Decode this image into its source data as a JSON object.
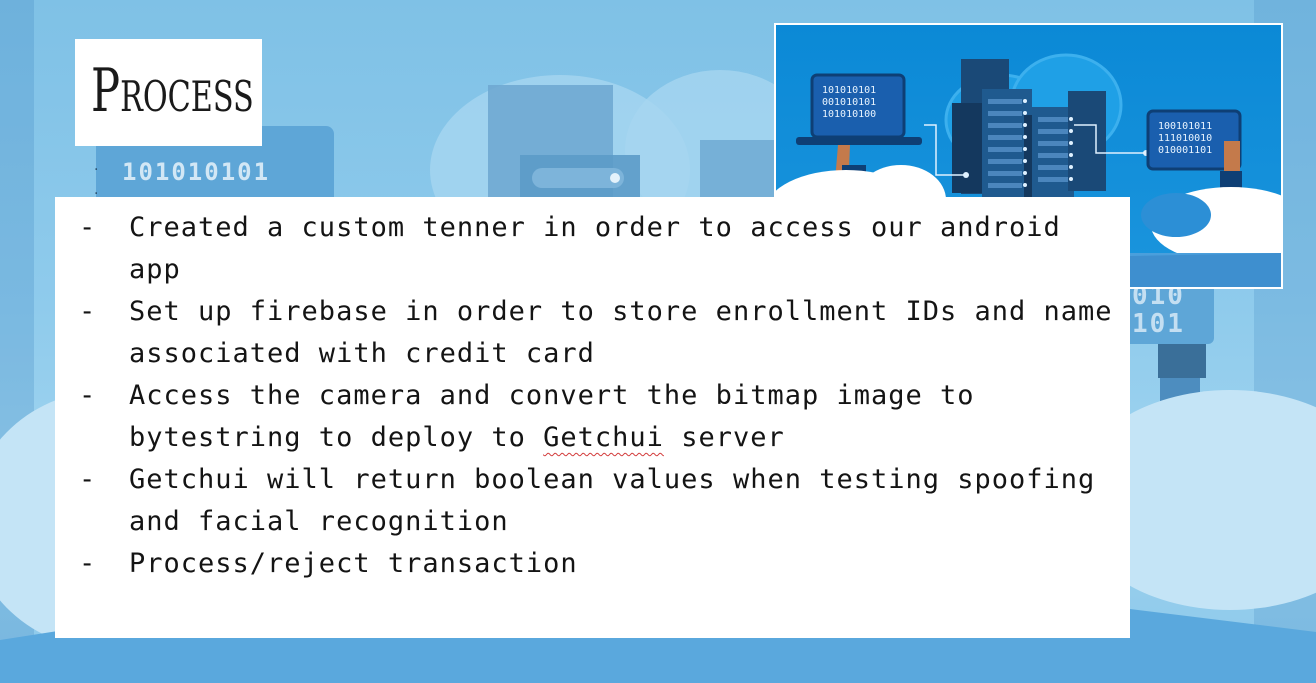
{
  "slide": {
    "title": "Process",
    "background_binary_1": "101010101",
    "background_binary_2_line1": "010",
    "background_binary_2_line2": "101",
    "illustration": {
      "laptop_binary": [
        "101010101",
        "001010101",
        "101010100"
      ],
      "monitor_binary": [
        "100101011",
        "111010010",
        "010001101"
      ]
    },
    "bullets": [
      {
        "text": "Created a custom tenner in order to access our android app"
      },
      {
        "text": "Set up firebase in order to store enrollment IDs and name associated with credit card"
      },
      {
        "text_before": "Access the camera and convert the bitmap image to bytestring to deploy to ",
        "flagged_word": "Getchui",
        "text_after": " server"
      },
      {
        "text": "Getchui will return boolean values when testing spoofing and facial recognition"
      },
      {
        "text": "Process/reject transaction"
      }
    ],
    "bullet_marker": "-",
    "colors": {
      "background_blue": "#8fcbec",
      "illustration_sky": "#0a84cf",
      "server_dark": "#1d4f7c",
      "spellcheck_red": "#d23a3a"
    }
  }
}
